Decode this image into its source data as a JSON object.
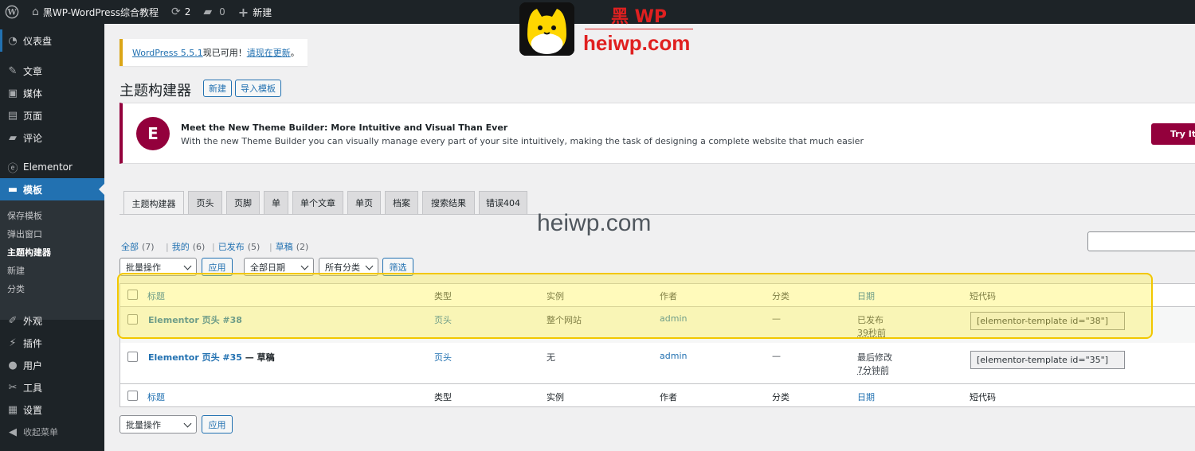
{
  "adminbar": {
    "wp_icon": "wordpress-icon",
    "site_name": "黑WP-WordPress综合教程",
    "updates_count": "2",
    "comments_count": "0",
    "new_label": "新建"
  },
  "sidebar": {
    "items": [
      {
        "label": "仪表盘",
        "icon": "dashboard-icon"
      },
      {
        "label": "文章",
        "icon": "pin-icon"
      },
      {
        "label": "媒体",
        "icon": "media-icon"
      },
      {
        "label": "页面",
        "icon": "page-icon"
      },
      {
        "label": "评论",
        "icon": "comment-icon"
      },
      {
        "label": "Elementor",
        "icon": "elementor-icon"
      },
      {
        "label": "模板",
        "icon": "folder-icon"
      },
      {
        "label": "外观",
        "icon": "brush-icon"
      },
      {
        "label": "插件",
        "icon": "plugin-icon"
      },
      {
        "label": "用户",
        "icon": "user-icon"
      },
      {
        "label": "工具",
        "icon": "wrench-icon"
      },
      {
        "label": "设置",
        "icon": "settings-icon"
      },
      {
        "label": "收起菜单",
        "icon": "collapse-icon"
      }
    ],
    "submenu": [
      "保存模板",
      "弹出窗口",
      "主题构建器",
      "新建",
      "分类"
    ]
  },
  "notice": {
    "link1": "WordPress 5.5.1",
    "text": "现已可用！",
    "link2": "请现在更新",
    "end": "。"
  },
  "brand": {
    "title": "黑 WP",
    "domain": "heiwp.com"
  },
  "header": {
    "title": "主题构建器",
    "new_btn": "新建",
    "import_btn": "导入模板"
  },
  "promo": {
    "logo_letter": "E",
    "title": "Meet the New Theme Builder: More Intuitive and Visual Than Ever",
    "desc": "With the new Theme Builder you can visually manage every part of your site intuitively, making the task of designing a complete website that much easier",
    "button": "Try It N"
  },
  "tabs": [
    "主题构建器",
    "页头",
    "页脚",
    "单",
    "单个文章",
    "单页",
    "档案",
    "搜索结果",
    "错误404"
  ],
  "watermark": "heiwp.com",
  "views": [
    {
      "label": "全部",
      "count": "(7)"
    },
    {
      "label": "我的",
      "count": "(6)"
    },
    {
      "label": "已发布",
      "count": "(5)"
    },
    {
      "label": "草稿",
      "count": "(2)"
    }
  ],
  "filters": {
    "bulk": "批量操作",
    "apply": "应用",
    "dates": "全部日期",
    "cats": "所有分类",
    "filter": "筛选"
  },
  "table": {
    "columns": [
      "标题",
      "类型",
      "实例",
      "作者",
      "分类",
      "日期",
      "短代码"
    ],
    "rows": [
      {
        "title": "Elementor 页头 #38",
        "draft": "",
        "type": "页头",
        "instance": "整个网站",
        "author": "admin",
        "category": "—",
        "status": "已发布",
        "time": "39秒前",
        "shortcode": "[elementor-template id=\"38\"]"
      },
      {
        "title": "Elementor 页头 #35",
        "draft": " — 草稿",
        "type": "页头",
        "instance": "无",
        "author": "admin",
        "category": "—",
        "status": "最后修改",
        "time": "7分钟前",
        "shortcode": "[elementor-template id=\"35\"]"
      }
    ]
  },
  "bottom": {
    "bulk": "批量操作",
    "apply": "应用"
  }
}
